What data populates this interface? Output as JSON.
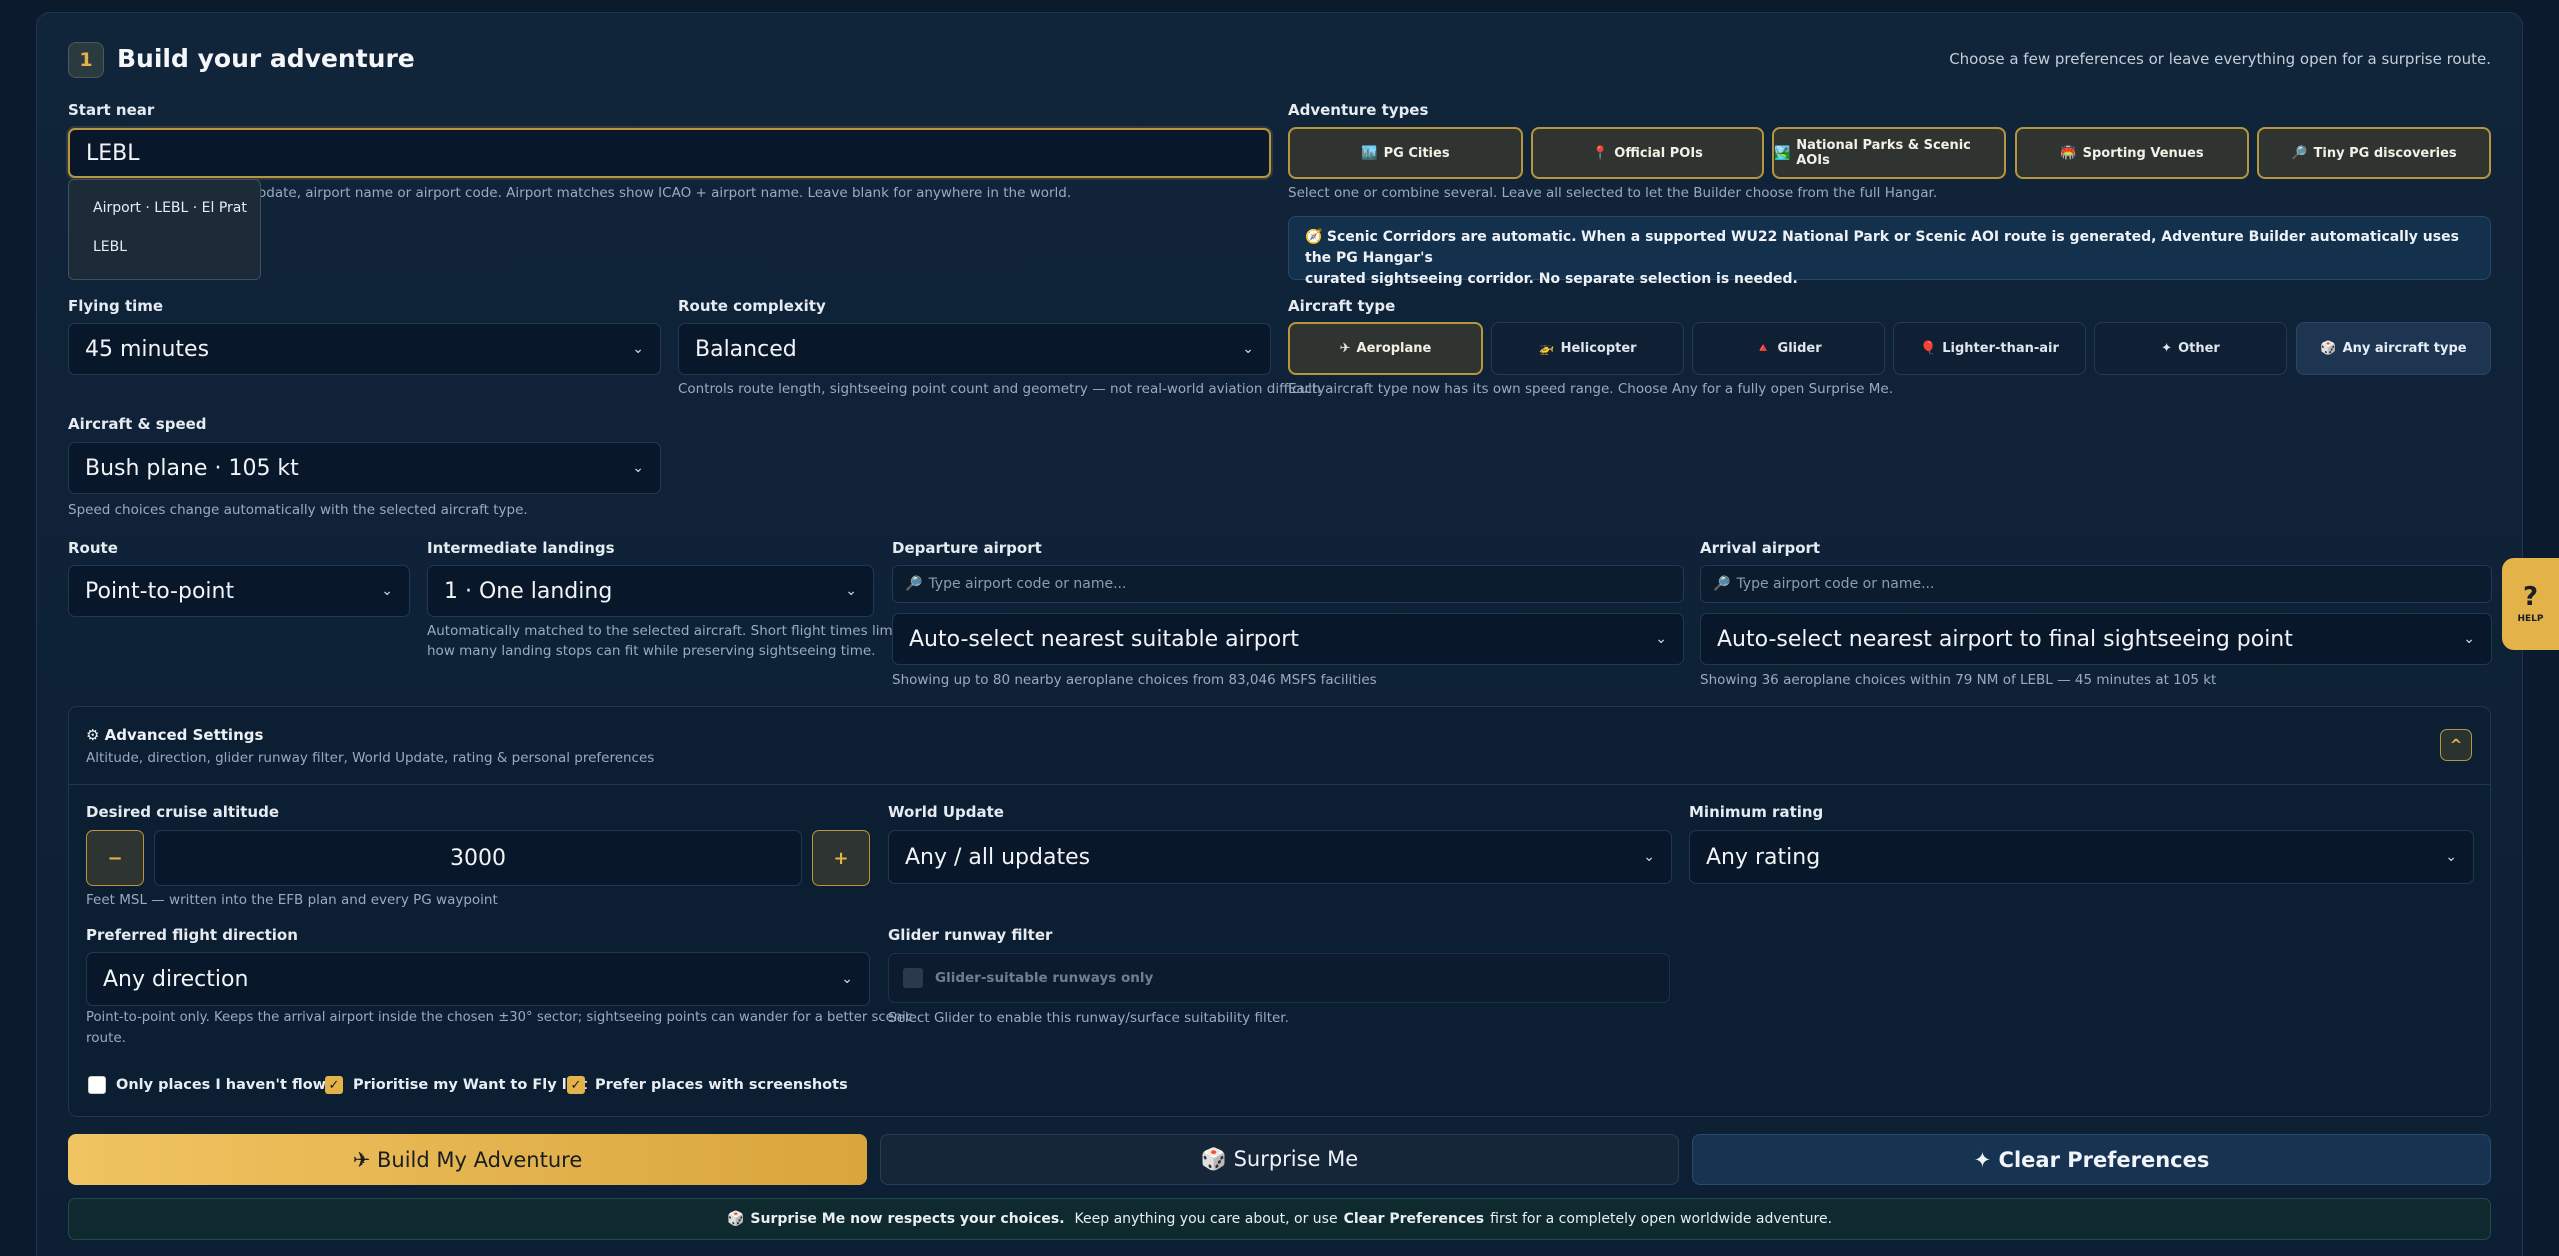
{
  "header": {
    "step_number": "1",
    "title": "Build your adventure",
    "subtitle": "Choose a few preferences or leave everything open for a surprise route."
  },
  "start_near": {
    "label": "Start near",
    "value": "LEBL",
    "hint": "odate, airport name or airport code. Airport matches show ICAO + airport name. Leave blank for anywhere in the world.",
    "suggestions": [
      "Airport · LEBL · El Prat",
      "LEBL"
    ]
  },
  "adventure_types": {
    "label": "Adventure types",
    "hint": "Select one or combine several. Leave all selected to let the Builder choose from the full Hangar.",
    "items": [
      {
        "icon": "🏙️",
        "label": "PG Cities"
      },
      {
        "icon": "📍",
        "label": "Official POIs"
      },
      {
        "icon": "🏞️",
        "label": "National Parks & Scenic AOIs"
      },
      {
        "icon": "🏟️",
        "label": "Sporting Venues"
      },
      {
        "icon": "🔎",
        "label": "Tiny PG discoveries"
      }
    ]
  },
  "scenic_notice": {
    "icon": "🧭",
    "bold": "Scenic Corridors are automatic.",
    "bold2": "When a supported WU22 National Park or Scenic AOI route is generated, Adventure Builder automatically uses the PG Hangar's",
    "text": "curated sightseeing corridor. No separate selection is needed."
  },
  "flying_time": {
    "label": "Flying time",
    "value": "45 minutes"
  },
  "route_complexity": {
    "label": "Route complexity",
    "value": "Balanced",
    "hint": "Controls route length, sightseeing point count and geometry — not real-world aviation difficulty"
  },
  "aircraft_type": {
    "label": "Aircraft type",
    "hint": "Each aircraft type now has its own speed range. Choose Any for a fully open Surprise Me.",
    "items": [
      {
        "icon": "✈",
        "label": "Aeroplane"
      },
      {
        "icon": "🚁",
        "label": "Helicopter"
      },
      {
        "icon": "🔺",
        "label": "Glider"
      },
      {
        "icon": "🎈",
        "label": "Lighter-than-air"
      },
      {
        "icon": "✦",
        "label": "Other"
      },
      {
        "icon": "🎲",
        "label": "Any aircraft type"
      }
    ]
  },
  "aircraft_speed": {
    "label": "Aircraft & speed",
    "value": "Bush plane · 105 kt",
    "hint": "Speed choices change automatically with the selected aircraft type."
  },
  "route": {
    "label": "Route",
    "value": "Point-to-point"
  },
  "landings": {
    "label": "Intermediate landings",
    "value": "1 · One landing",
    "hint1": "Automatically matched to the selected aircraft. Short flight times limit",
    "hint2": "how many landing stops can fit while preserving sightseeing time."
  },
  "departure": {
    "label": "Departure airport",
    "placeholder": "Type airport code or name...",
    "value": "Auto-select nearest suitable airport",
    "hint": "Showing up to 80 nearby aeroplane choices from 83,046 MSFS facilities"
  },
  "arrival": {
    "label": "Arrival airport",
    "placeholder": "Type airport code or name...",
    "value": "Auto-select nearest airport to final sightseeing point",
    "hint": "Showing 36 aeroplane choices within 79 NM of LEBL — 45 minutes at 105 kt"
  },
  "help_label": "HELP",
  "advanced": {
    "title": "⚙ Advanced Settings",
    "subtitle": "Altitude, direction, glider runway filter, World Update, rating & personal preferences",
    "toggle": "^",
    "altitude": {
      "label": "Desired cruise altitude",
      "minus": "−",
      "plus": "+",
      "value": "3000",
      "hint": "Feet MSL — written into the EFB plan and every PG waypoint"
    },
    "world_update": {
      "label": "World Update",
      "value": "Any / all updates"
    },
    "min_rating": {
      "label": "Minimum rating",
      "value": "Any rating"
    },
    "direction": {
      "label": "Preferred flight direction",
      "value": "Any direction",
      "hint1": "Point-to-point only. Keeps the arrival airport inside the chosen ±30° sector; sightseeing points can wander for a better scenic",
      "hint2": "route."
    },
    "glider": {
      "label": "Glider runway filter",
      "option": "Glider-suitable runways only",
      "hint": "Select Glider to enable this runway/surface suitability filter."
    },
    "checks": [
      {
        "label": "Only places I haven't flown",
        "checked": false
      },
      {
        "label": "Prioritise my Want to Fly list",
        "checked": true
      },
      {
        "label": "Prefer places with screenshots",
        "checked": true
      }
    ]
  },
  "actions": {
    "build": "✈ Build My Adventure",
    "surprise": "🎲 Surprise Me",
    "clear": "✦ Clear Preferences"
  },
  "footer": {
    "icon": "🎲",
    "bold": "Surprise Me now respects your choices.",
    "text1": "Keep anything you care about, or use",
    "bold2": "Clear Preferences",
    "text2": "first for a completely open worldwide adventure."
  },
  "colors": {
    "accent": "#e3b34a",
    "background": "#0b1a2c",
    "panel": "#10243a"
  }
}
